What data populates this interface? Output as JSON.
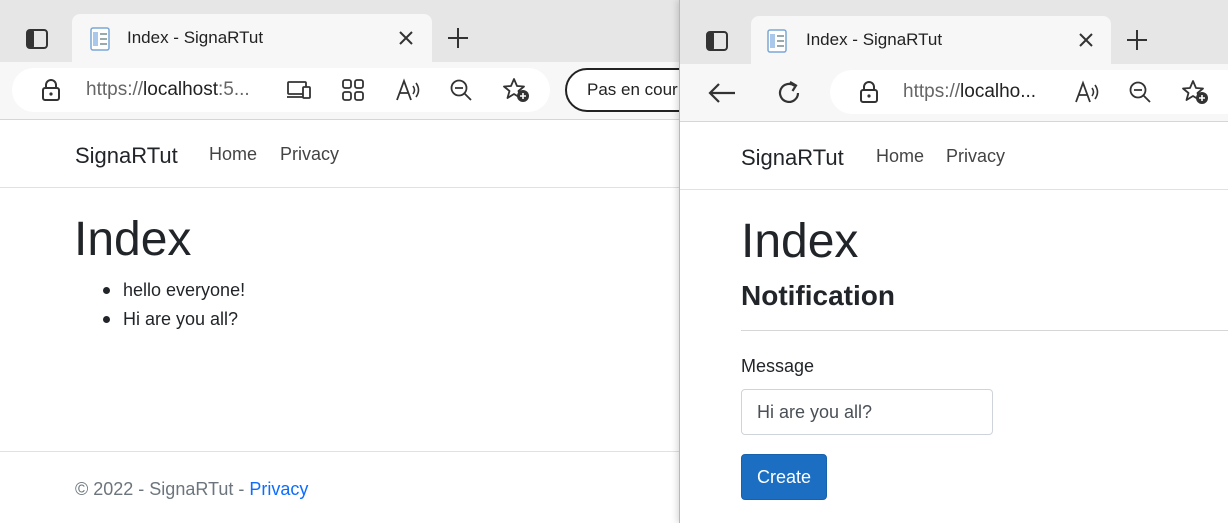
{
  "left_window": {
    "tab": {
      "title": "Index - SignaRTut",
      "close_icon": "close-icon"
    },
    "new_tab_icon": "plus-icon",
    "address": {
      "prefix": "https://",
      "host": "localhost",
      "suffix": ":5..."
    },
    "pill_button": "Pas en cour",
    "page": {
      "brand": "SignaRTut",
      "nav": [
        "Home",
        "Privacy"
      ],
      "heading": "Index",
      "messages": [
        "hello everyone!",
        "Hi are you all?"
      ],
      "footer": {
        "text": "© 2022 - SignaRTut - ",
        "link": "Privacy"
      }
    }
  },
  "right_window": {
    "tab": {
      "title": "Index - SignaRTut"
    },
    "address": {
      "prefix": "https://",
      "host": "localho..."
    },
    "page": {
      "brand": "SignaRTut",
      "nav": [
        "Home",
        "Privacy"
      ],
      "heading": "Index",
      "subheading": "Notification",
      "form": {
        "message_label": "Message",
        "message_value": "Hi are you all?",
        "create_button": "Create"
      }
    }
  },
  "colors": {
    "primary": "#1b6ec2",
    "link": "#0d6efd",
    "text": "#212529",
    "muted": "#6c757d"
  }
}
